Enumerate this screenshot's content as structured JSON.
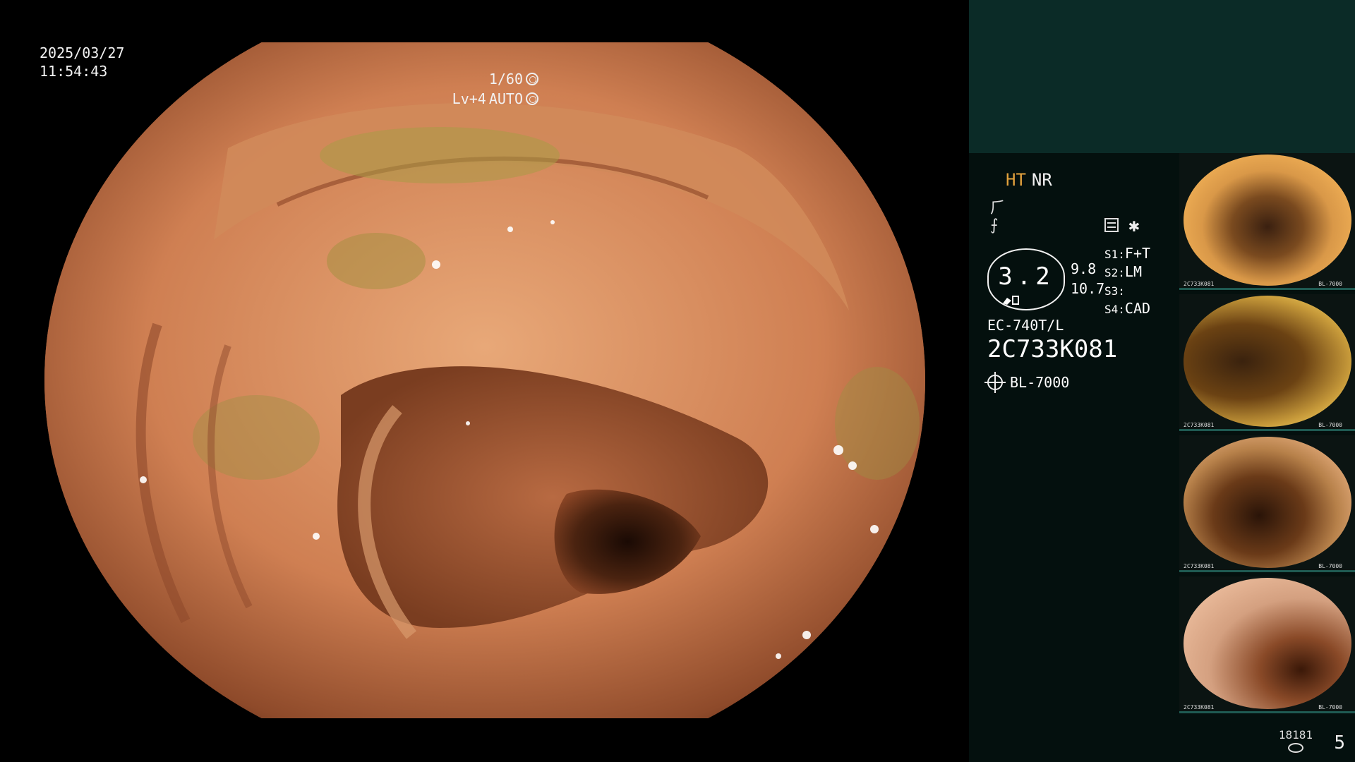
{
  "overlay": {
    "date": "2025/03/27",
    "time": "11:54:43",
    "shutter": "1/60",
    "level": "Lv+4",
    "mode": "AUTO"
  },
  "panel": {
    "ht": "HT",
    "nr": "NR",
    "sym1": "⺁",
    "sym2": "⨍",
    "asterisk": "✱",
    "zoom": "3.2",
    "value1": "9.8",
    "value2": "10.7",
    "s1_label": "S1:",
    "s1_value": "F+T",
    "s2_label": "S2:",
    "s2_value": "LM",
    "s3_label": "S3:",
    "s3_value": "",
    "s4_label": "S4:",
    "s4_value": "CAD",
    "scope_model": "EC-740T/L",
    "serial": "2C733K081",
    "light_source": "BL-7000"
  },
  "thumbnails": [
    {
      "code": "2C733K081",
      "light": "BL-7000",
      "index": "4"
    },
    {
      "code": "2C733K081",
      "light": "BL-7000",
      "index": "3"
    },
    {
      "code": "2C733K081",
      "light": "BL-7000",
      "index": "2"
    },
    {
      "code": "2C733K081",
      "light": "BL-7000",
      "index": "1"
    }
  ],
  "footer": {
    "count": "18181",
    "page": "5"
  },
  "colors": {
    "ht": "#e3a23d",
    "panel_bg": "#04100e",
    "panel_top": "#0b2b27"
  }
}
